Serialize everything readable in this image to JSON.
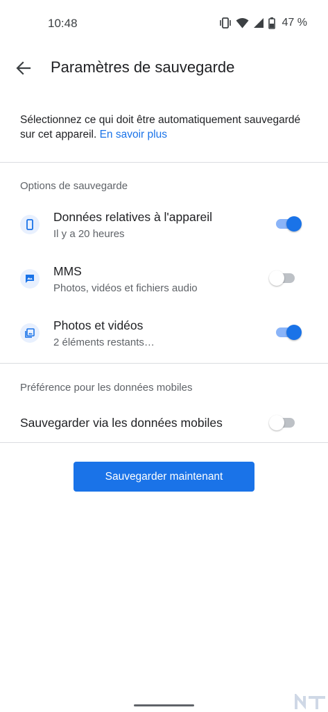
{
  "status_bar": {
    "time": "10:48",
    "battery_percent": "47 %",
    "icons": [
      "vibrate-icon",
      "wifi-icon",
      "signal-icon",
      "battery-icon"
    ]
  },
  "app_bar": {
    "title": "Paramètres de sauvegarde",
    "back_icon": "arrow-back-icon"
  },
  "intro": {
    "text": "Sélectionnez ce qui doit être automatiquement sauvegardé sur cet appareil.",
    "link": "En savoir plus"
  },
  "backup_options": {
    "title": "Options de sauvegarde",
    "items": [
      {
        "icon": "phone-icon",
        "title": "Données relatives à l'appareil",
        "subtitle": "Il y a 20 heures",
        "enabled": true
      },
      {
        "icon": "mms-icon",
        "title": "MMS",
        "subtitle": "Photos, vidéos et fichiers audio",
        "enabled": false
      },
      {
        "icon": "photos-icon",
        "title": "Photos et vidéos",
        "subtitle": "2 éléments restants…",
        "enabled": true
      }
    ]
  },
  "mobile_data": {
    "title": "Préférence pour les données mobiles",
    "option_label": "Sauvegarder via les données mobiles",
    "enabled": false
  },
  "actions": {
    "backup_now": "Sauvegarder maintenant"
  },
  "watermark": {
    "text": "NT"
  },
  "colors": {
    "accent": "#1a73e8",
    "accent_light": "#8ab4f8",
    "icon_bg": "#e8f0fe",
    "divider": "#dadce0",
    "secondary_text": "#5f6368"
  }
}
